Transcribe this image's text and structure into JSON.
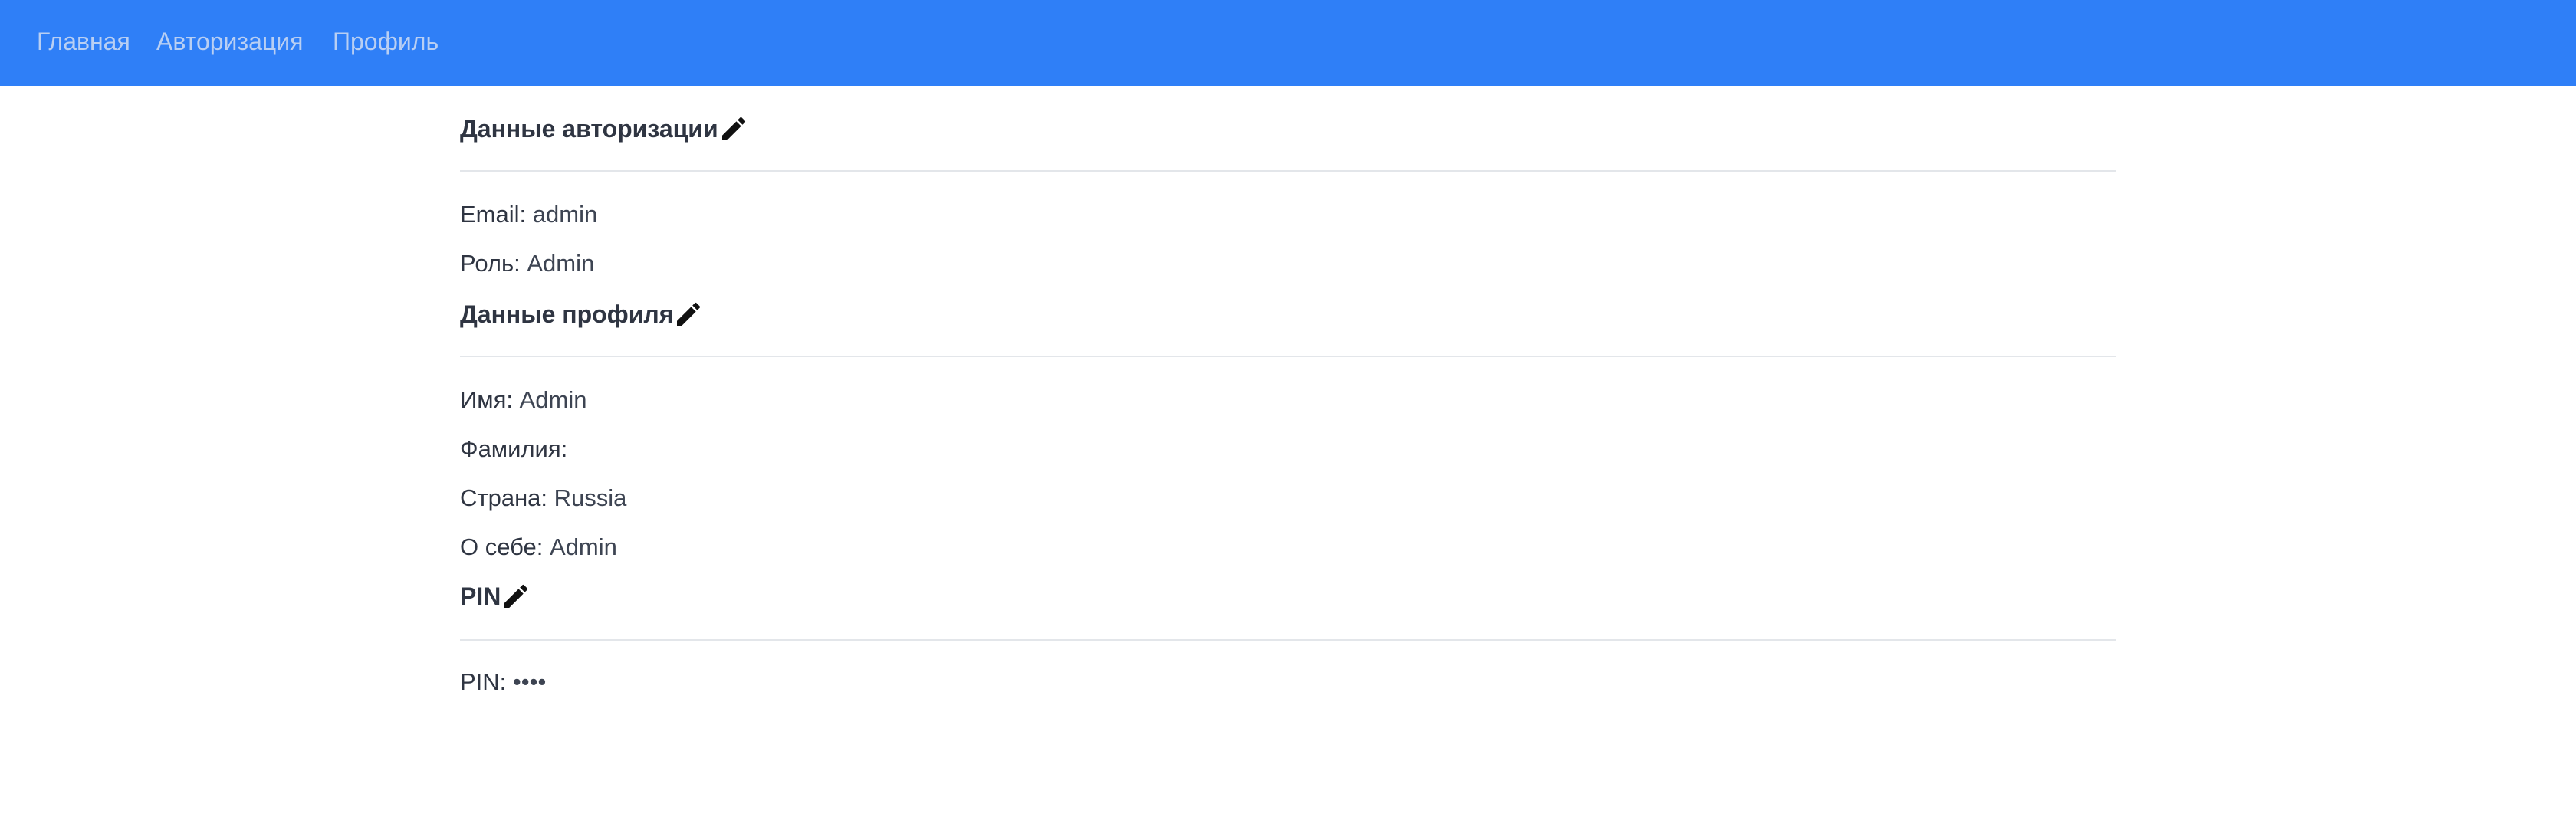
{
  "nav": {
    "items": [
      {
        "label": "Главная"
      },
      {
        "label": "Авторизация"
      },
      {
        "label": "Профиль"
      }
    ]
  },
  "sections": {
    "auth": {
      "title": "Данные авторизации",
      "fields": [
        {
          "label": "Email:",
          "value": "admin"
        },
        {
          "label": "Роль:",
          "value": "Admin"
        }
      ]
    },
    "profile": {
      "title": "Данные профиля",
      "fields": [
        {
          "label": "Имя:",
          "value": "Admin"
        },
        {
          "label": "Фамилия:",
          "value": ""
        },
        {
          "label": "Страна:",
          "value": "Russia"
        },
        {
          "label": "О себе:",
          "value": "Admin"
        }
      ]
    },
    "pin": {
      "title": "PIN",
      "fields": [
        {
          "label": "PIN:",
          "value": "••••"
        }
      ]
    }
  },
  "colors": {
    "navbar": "#2f7ff7",
    "nav_link": "#b9cff3",
    "text": "#2f3542",
    "divider": "#e3e6ea"
  },
  "icons": {
    "edit": "pencil-icon"
  }
}
